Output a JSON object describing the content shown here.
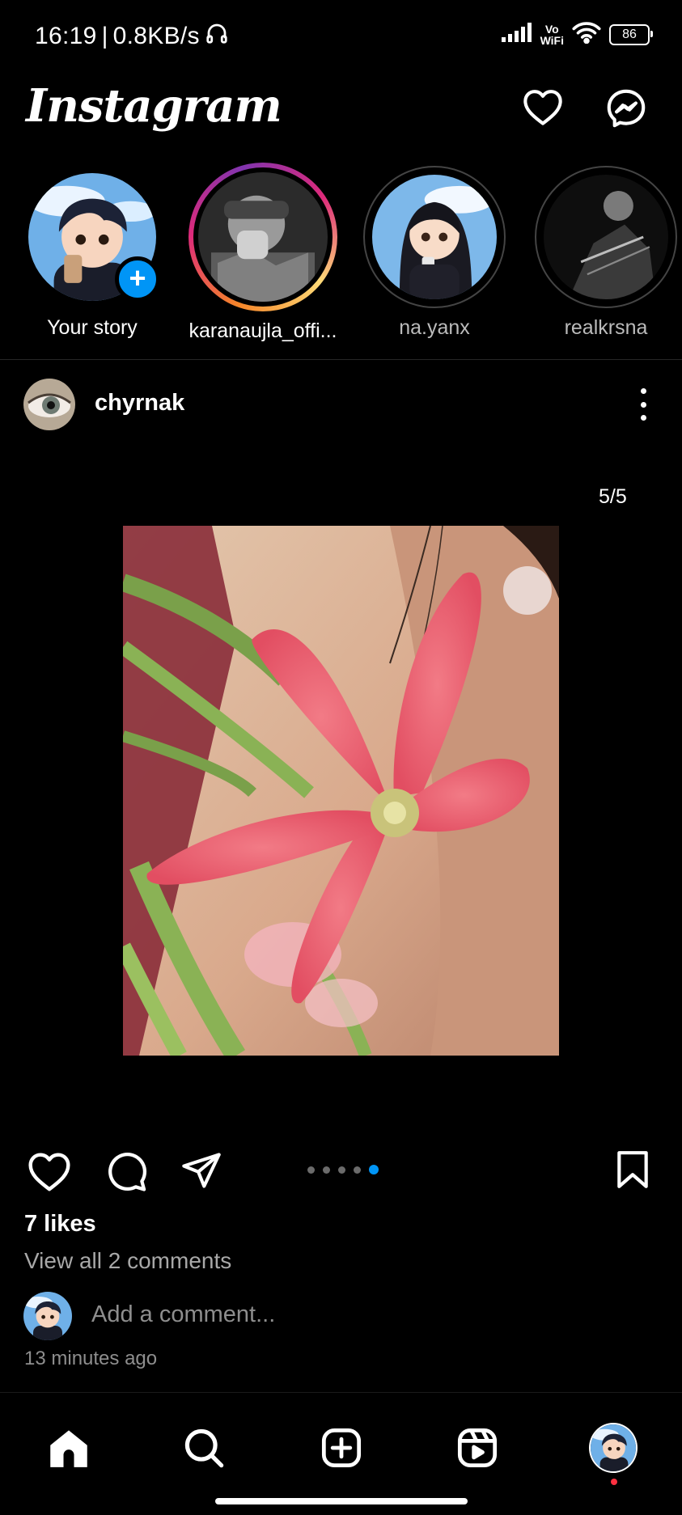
{
  "status_bar": {
    "time": "16:19",
    "separator": "|",
    "speed": "0.8KB/s",
    "network_label_top": "Vo",
    "network_label_bottom": "WiFi",
    "battery": "86"
  },
  "header": {
    "logo": "Instagram",
    "icons": [
      "heart-icon",
      "messenger-icon"
    ]
  },
  "stories": [
    {
      "label": "Your story",
      "type": "own"
    },
    {
      "label": "karanaujla_offi...",
      "type": "unseen"
    },
    {
      "label": "na.yanx",
      "type": "seen"
    },
    {
      "label": "realkrsna",
      "type": "seen"
    }
  ],
  "post": {
    "username": "chyrnak",
    "counter": "5/5",
    "carousel": {
      "count": 5,
      "active_index": 4
    },
    "likes": "7 likes",
    "view_comments": "View all 2 comments",
    "comment_placeholder": "Add a comment...",
    "timestamp": "13 minutes ago"
  },
  "bottom_nav": {
    "items": [
      "home-icon",
      "search-icon",
      "create-icon",
      "reels-icon",
      "profile-avatar"
    ]
  },
  "colors": {
    "background": "#000000",
    "accent_blue": "#0095f6",
    "muted_text": "#a8a8a8",
    "notification_red": "#ff3040"
  }
}
